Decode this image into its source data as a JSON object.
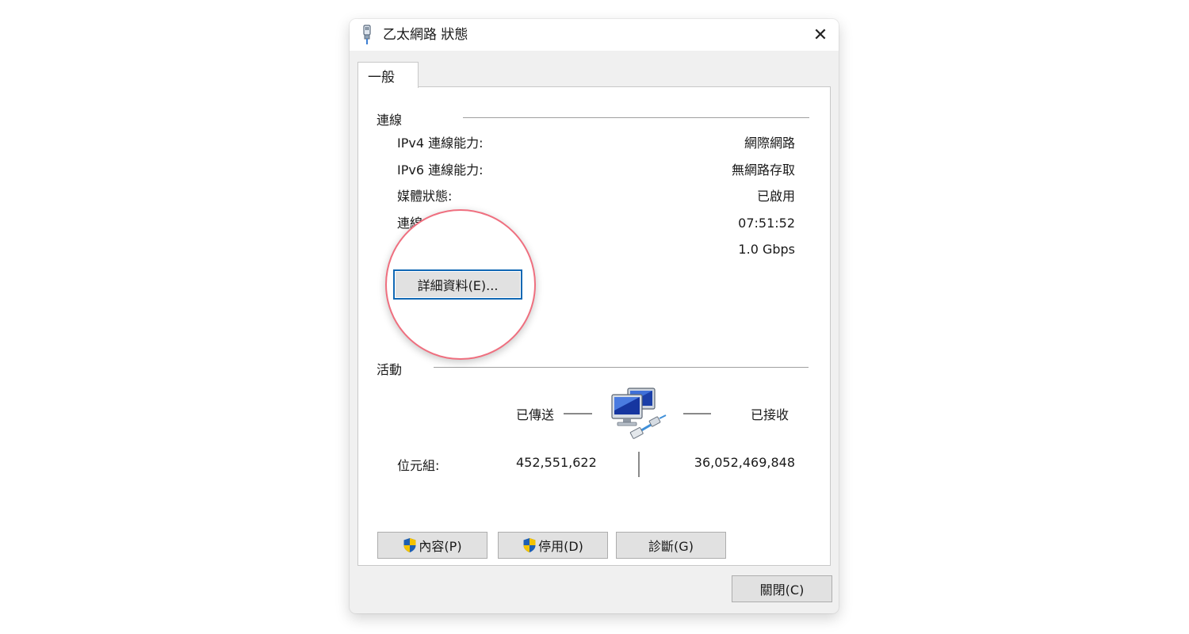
{
  "window": {
    "title": "乙太網路 狀態",
    "icon": "network-adapter-icon",
    "close_glyph": "✕"
  },
  "tabs": [
    {
      "label": "一般",
      "selected": true
    }
  ],
  "connection": {
    "section_title": "連線",
    "rows": [
      {
        "label": "IPv4 連線能力:",
        "value": "網際網路"
      },
      {
        "label": "IPv6 連線能力:",
        "value": "無網路存取"
      },
      {
        "label": "媒體狀態:",
        "value": "已啟用"
      },
      {
        "label": "連線",
        "value": "07:51:52"
      },
      {
        "label": "",
        "value": "1.0 Gbps"
      }
    ],
    "details_button": "詳細資料(E)..."
  },
  "activity": {
    "section_title": "活動",
    "sent_label": "已傳送",
    "received_label": "已接收",
    "bytes_label": "位元組:",
    "bytes_sent": "452,551,622",
    "bytes_received": "36,052,469,848",
    "icon": "network-computers-icon"
  },
  "buttons": {
    "properties": "內容(P)",
    "disable": "停用(D)",
    "diagnose": "診斷(G)",
    "close": "關閉(C)"
  },
  "colors": {
    "focus_border": "#1168b4",
    "highlight_ring": "#ef6f7f",
    "dialog_bg": "#f0f0f0"
  }
}
